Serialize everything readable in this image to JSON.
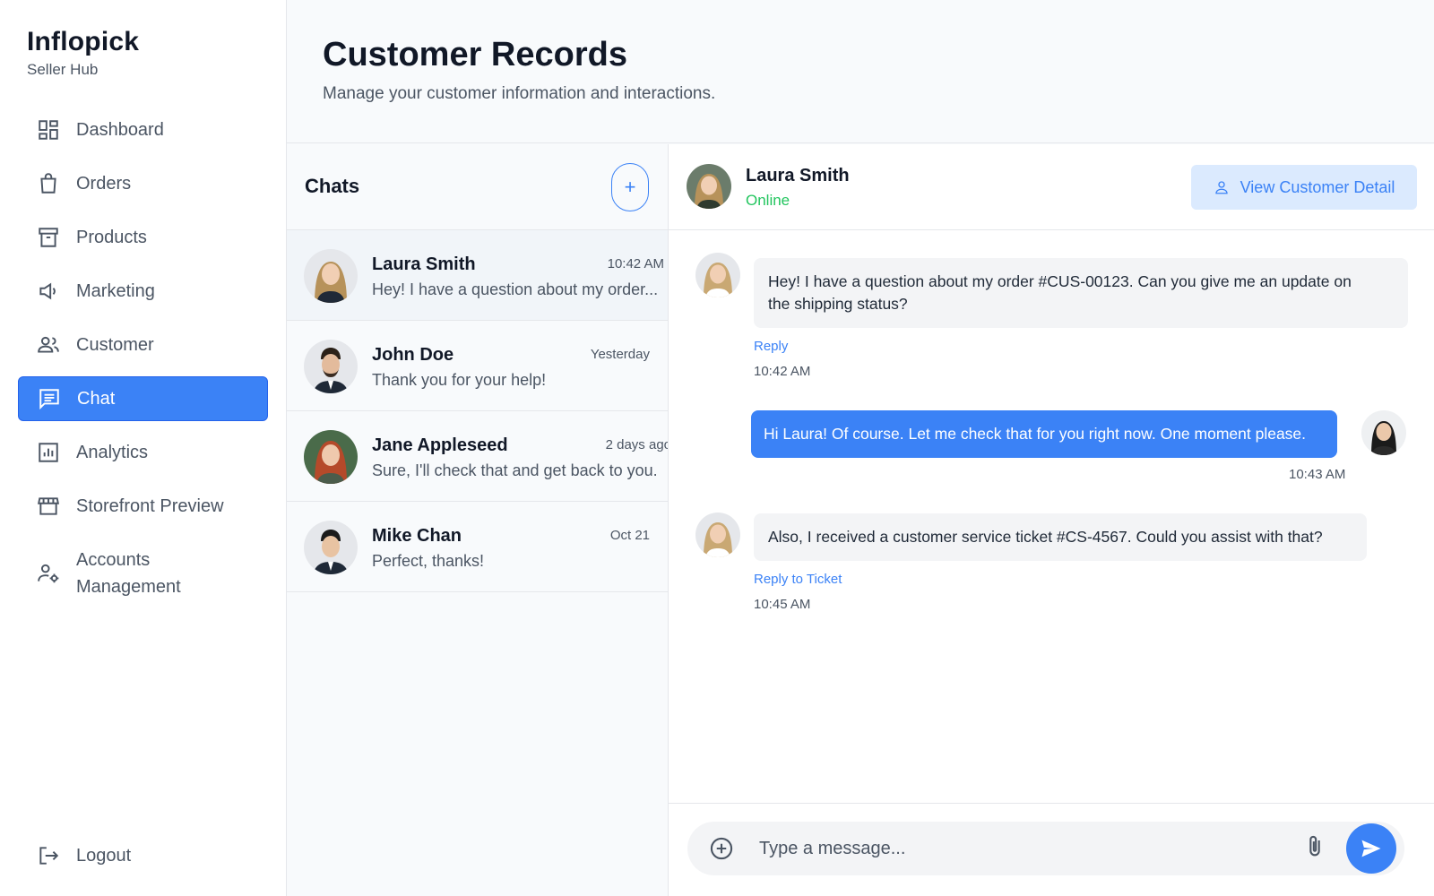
{
  "brand": {
    "title": "Inflopick",
    "subtitle": "Seller Hub"
  },
  "sidebar": {
    "items": [
      {
        "label": "Dashboard",
        "icon": "dashboard-icon"
      },
      {
        "label": "Orders",
        "icon": "shopping-bag-icon"
      },
      {
        "label": "Products",
        "icon": "archive-box-icon"
      },
      {
        "label": "Marketing",
        "icon": "megaphone-icon"
      },
      {
        "label": "Customer",
        "icon": "users-icon"
      },
      {
        "label": "Chat",
        "icon": "chat-icon",
        "active": true
      },
      {
        "label": "Analytics",
        "icon": "bar-chart-icon"
      },
      {
        "label": "Storefront Preview",
        "icon": "store-icon"
      },
      {
        "label": "Accounts Management",
        "icon": "user-settings-icon"
      }
    ],
    "logout": {
      "label": "Logout",
      "icon": "logout-icon"
    }
  },
  "header": {
    "title": "Customer Records",
    "subtitle": "Manage your customer information and interactions."
  },
  "chatlist": {
    "title": "Chats",
    "new_chat_label": "+",
    "conversations": [
      {
        "name": "Laura Smith",
        "time": "10:42 AM",
        "preview": "Hey! I have a question about my order...",
        "selected": true
      },
      {
        "name": "John Doe",
        "time": "Yesterday",
        "preview": "Thank you for your help!"
      },
      {
        "name": "Jane Appleseed",
        "time": "2 days ago",
        "preview": "Sure, I'll check that and get back to you."
      },
      {
        "name": "Mike Chan",
        "time": "Oct 21",
        "preview": "Perfect, thanks!"
      }
    ]
  },
  "chat": {
    "contact_name": "Laura Smith",
    "contact_status": "Online",
    "view_detail_label": "View Customer Detail",
    "messages": [
      {
        "direction": "incoming",
        "text_line1": "Hey! I have a question about my order #CUS-00123. Can you give me an update on",
        "text_line2": "the shipping status?",
        "action": "Reply",
        "time": "10:42 AM"
      },
      {
        "direction": "outgoing",
        "text": "Hi Laura! Of course. Let me check that for you right now. One moment please.",
        "time": "10:43 AM"
      },
      {
        "direction": "incoming",
        "text": "Also, I received a customer service ticket #CS-4567. Could you assist with that?",
        "action": "Reply to Ticket",
        "time": "10:45 AM"
      }
    ],
    "composer": {
      "placeholder": "Type a message..."
    }
  },
  "colors": {
    "accent": "#3b82f6",
    "online": "#22c55e",
    "accent_soft": "#dbeafe"
  }
}
